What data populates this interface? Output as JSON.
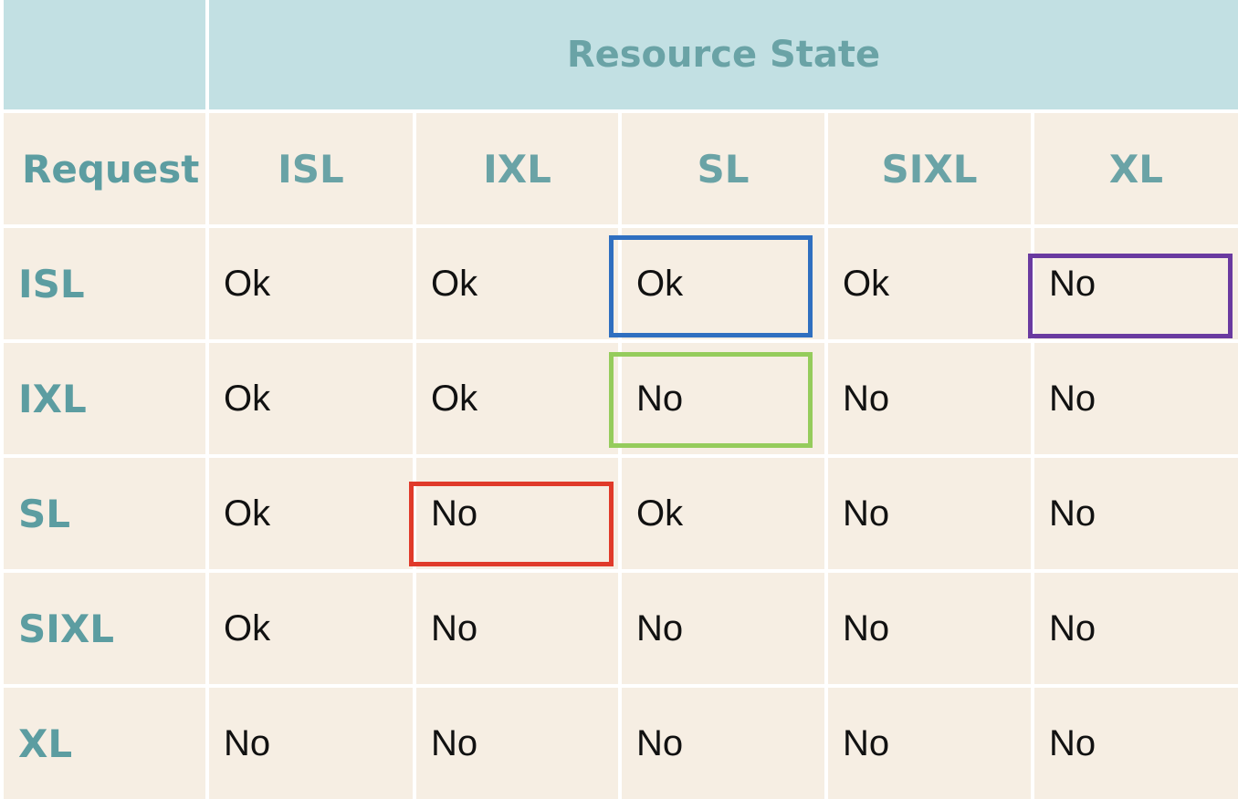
{
  "table": {
    "title": "Resource State",
    "corner_label": "Request",
    "columns": [
      "ISL",
      "IXL",
      "SL",
      "SIXL",
      "XL"
    ],
    "rows": [
      {
        "label": "ISL",
        "values": [
          "Ok",
          "Ok",
          "Ok",
          "Ok",
          "No"
        ]
      },
      {
        "label": "IXL",
        "values": [
          "Ok",
          "Ok",
          "No",
          "No",
          "No"
        ]
      },
      {
        "label": "SL",
        "values": [
          "Ok",
          "No",
          "Ok",
          "No",
          "No"
        ]
      },
      {
        "label": "SIXL",
        "values": [
          "Ok",
          "No",
          "No",
          "No",
          "No"
        ]
      },
      {
        "label": "XL",
        "values": [
          "No",
          "No",
          "No",
          "No",
          "No"
        ]
      }
    ]
  },
  "highlights": [
    {
      "name": "highlight-blue-isl-sl",
      "color": "#2f6fc0"
    },
    {
      "name": "highlight-purple-isl-xl",
      "color": "#6a3aa0"
    },
    {
      "name": "highlight-green-ixl-sl",
      "color": "#95cc5c"
    },
    {
      "name": "highlight-red-sl-ixl",
      "color": "#e03a2a"
    }
  ],
  "colors": {
    "header_bg": "#c2e0e3",
    "cell_bg": "#f6eee3",
    "header_text": "#6aa3a6"
  }
}
